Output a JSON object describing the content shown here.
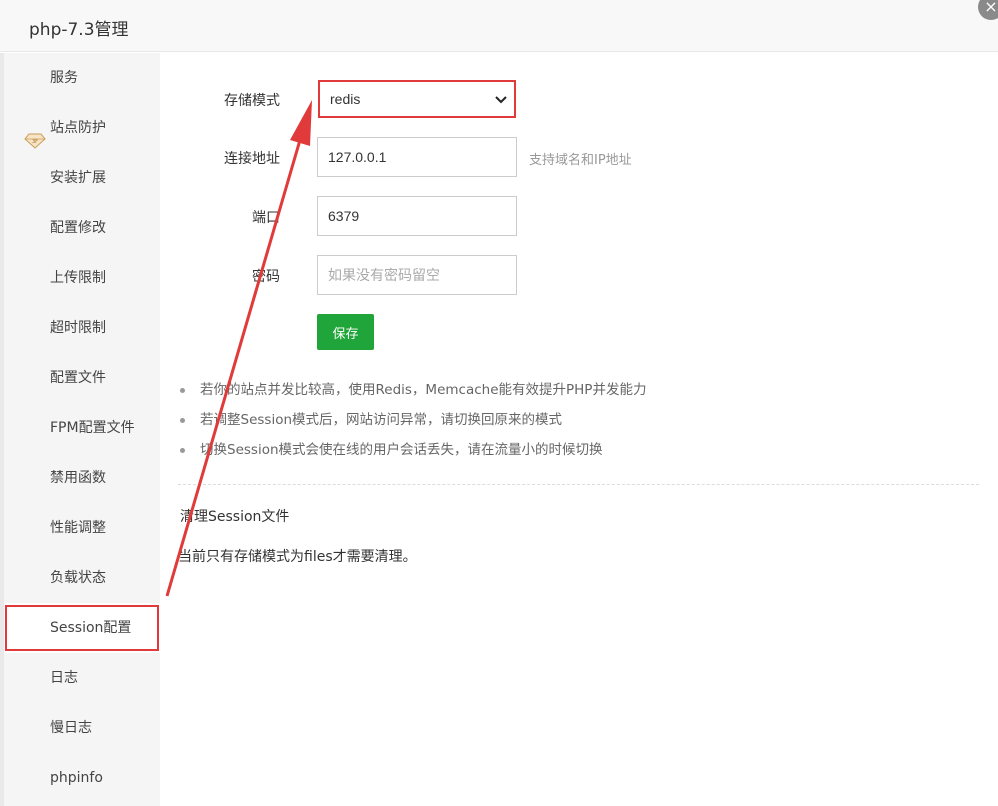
{
  "window": {
    "title": "php-7.3管理",
    "close_symbol": "×"
  },
  "sidebar": {
    "items": [
      {
        "label": "服务"
      },
      {
        "label": "站点防护",
        "icon": "diamond-icon"
      },
      {
        "label": "安装扩展"
      },
      {
        "label": "配置修改"
      },
      {
        "label": "上传限制"
      },
      {
        "label": "超时限制"
      },
      {
        "label": "配置文件"
      },
      {
        "label": "FPM配置文件"
      },
      {
        "label": "禁用函数"
      },
      {
        "label": "性能调整"
      },
      {
        "label": "负载状态"
      },
      {
        "label": "Session配置",
        "active": true
      },
      {
        "label": "日志"
      },
      {
        "label": "慢日志"
      },
      {
        "label": "phpinfo"
      }
    ]
  },
  "form": {
    "storage_label": "存储模式",
    "storage_value": "redis",
    "host_label": "连接地址",
    "host_value": "127.0.0.1",
    "host_hint": "支持域名和IP地址",
    "port_label": "端口",
    "port_value": "6379",
    "password_label": "密码",
    "password_placeholder": "如果没有密码留空",
    "save_label": "保存"
  },
  "tips": [
    "若你的站点并发比较高，使用Redis，Memcache能有效提升PHP并发能力",
    "若调整Session模式后，网站访问异常，请切换回原来的模式",
    "切换Session模式会使在线的用户会话丢失，请在流量小的时候切换"
  ],
  "cleanup": {
    "title": "清理Session文件",
    "note": "当前只有存储模式为files才需要清理。"
  },
  "colors": {
    "accent_green": "#20a53a",
    "annotation_red": "#e03a3a"
  }
}
